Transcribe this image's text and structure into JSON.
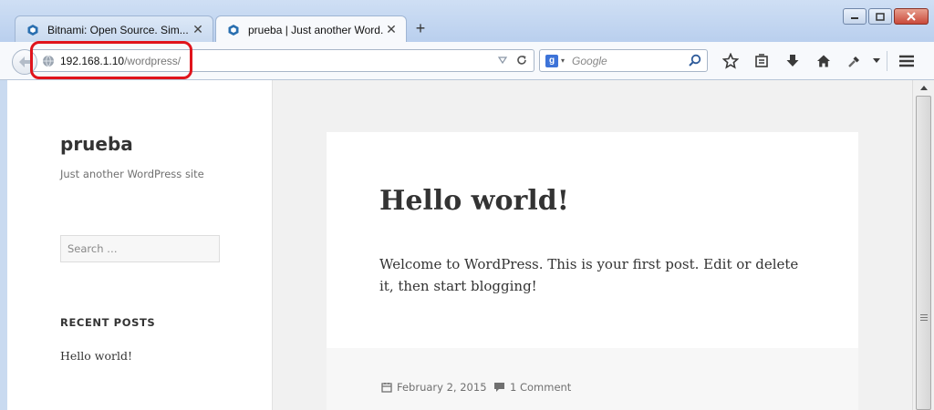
{
  "browser": {
    "tabs": [
      {
        "title": "Bitnami: Open Source. Sim...",
        "active": false,
        "icon": "bitnami-icon"
      },
      {
        "title": "prueba | Just another Word...",
        "active": true,
        "icon": "bitnami-icon"
      }
    ],
    "new_tab_label": "+",
    "url": {
      "host": "192.168.1.10",
      "path": "/wordpress/"
    },
    "search": {
      "placeholder": "Google",
      "engine_label": "g"
    },
    "colors": {
      "highlight": "#e0141c",
      "tab_strip": "#c9daf0"
    }
  },
  "site": {
    "title": "prueba",
    "description": "Just another WordPress site",
    "search_placeholder": "Search …",
    "recent_posts_heading": "RECENT POSTS",
    "recent_posts": [
      "Hello world!"
    ]
  },
  "post": {
    "title": "Hello world!",
    "content": "Welcome to WordPress. This is your first post. Edit or delete it, then start blogging!",
    "date": "February 2, 2015",
    "comments": "1 Comment"
  }
}
